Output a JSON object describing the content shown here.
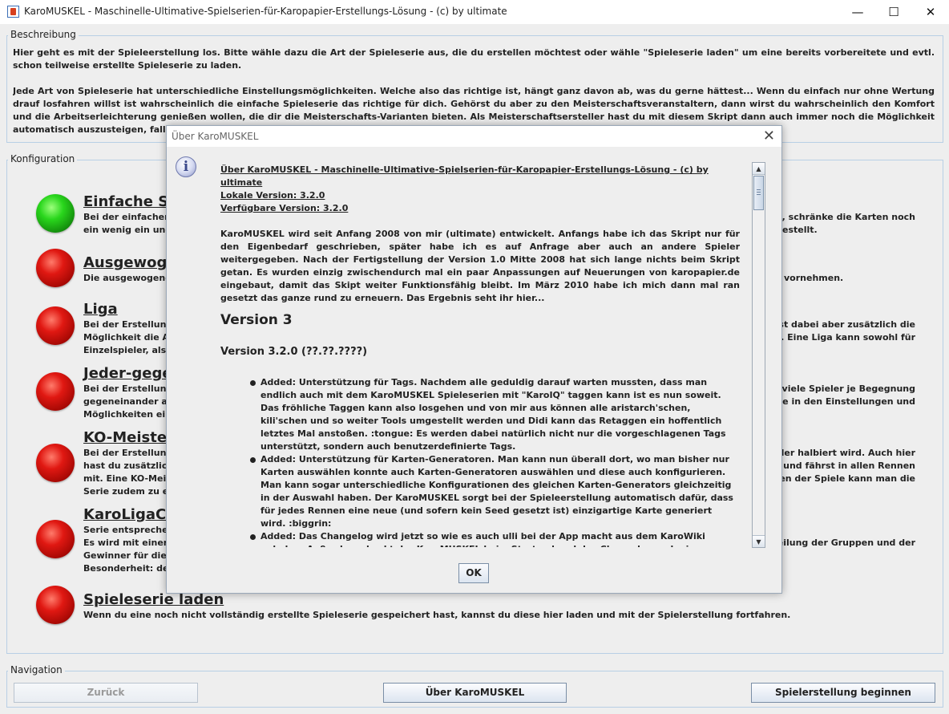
{
  "window": {
    "title": "KaroMUSKEL - Maschinelle-Ultimative-Spielserien-für-Karopapier-Erstellungs-Lösung - (c) by ultimate"
  },
  "beschreibung": {
    "title": "Beschreibung",
    "para1": "Hier geht es mit der Spieleerstellung los. Bitte wähle dazu die Art der Spieleserie aus, die du erstellen möchtest oder wähle \"Spieleserie laden\" um eine bereits vorbereitete und evtl. schon teilweise erstellte Spieleserie zu laden.",
    "para2": "Jede Art von Spieleserie hat unterschiedliche Einstellungsmöglichkeiten. Welche also das richtige ist, hängt ganz davon ab, was du gerne hättest... Wenn du einfach nur ohne Wertung drauf losfahren willst ist wahrscheinlich die einfache Spieleserie das richtige für dich. Gehörst du aber zu den Meisterschaftsveranstaltern, dann wirst du wahrscheinlich den Komfort und die Arbeitserleichterung genießen wollen, die dir die Meisterschafts-Varianten bieten. Als Meisterschaftsersteller hast du mit diesem Skript dann auch immer noch die Möglichkeit automatisch auszusteigen, falls es dir dann dochmal zu viele Spiele werden..."
  },
  "konfiguration": {
    "title": "Konfiguration",
    "items": [
      {
        "title": "Einfache Sp",
        "lines": [
          "Bei der einfachen",
          "ein wenig ein und s"
        ],
        "right": [
          "est, schränke die Karten noch",
          "estellt."
        ],
        "status": "green"
      },
      {
        "title": "Ausgewoge",
        "lines": [
          "Die ausgewogene"
        ],
        "right": [
          "vornehmen."
        ],
        "status": "red"
      },
      {
        "title": "Liga",
        "lines": [
          "Bei der Erstellung",
          "Möglichkeit die An",
          "Einzelspieler, als a"
        ],
        "right": [
          "ast dabei aber zusätzlich die",
          "mit. Eine Liga kann sowohl für"
        ],
        "status": "red"
      },
      {
        "title": "Jeder-gegen",
        "lines": [
          "Bei der Erstellung",
          "gegeneinander an",
          "Möglichkeiten eine"
        ],
        "right": [
          "vie viele Spieler je Begegnung",
          "erie in den Einstellungen und"
        ],
        "status": "red"
      },
      {
        "title": "KO-Meisters",
        "lines": [
          "Bei der Erstellung",
          "hast du zusätzlich",
          "mit. Eine KO-Meist",
          "Serie zudem zu ein"
        ],
        "right": [
          "pieler halbiert wird. Auch hier",
          "ein und fährst in allen Rennen",
          "ellen der Spiele kann man die"
        ],
        "status": "red"
      },
      {
        "title": "KaroLigaCu",
        "lines": [
          "Serie entsprechen",
          "Es wird mit einer",
          "Gewinner für die n",
          "Besonderheit: der"
        ],
        "right": [
          "uteilung der Gruppen und der"
        ],
        "status": "red"
      },
      {
        "title": "Spieleserie laden",
        "lines": [
          "Wenn du eine noch nicht vollständig erstellte Spieleserie gespeichert hast, kannst du diese hier laden und mit der Spielerstellung fortfahren."
        ],
        "right": [],
        "status": "red"
      }
    ]
  },
  "navigation": {
    "title": "Navigation",
    "back": "Zurück",
    "about": "Über KaroMUSKEL",
    "start": "Spielerstellung beginnen"
  },
  "dialog": {
    "title": "Über KaroMUSKEL",
    "heading": "Über KaroMUSKEL - Maschinelle-Ultimative-Spielserien-für-Karopapier-Erstellungs-Lösung - (c) by ultimate",
    "local_version": "Lokale Version: 3.2.0",
    "available_version": "Verfügbare Version: 3.2.0",
    "intro": "KaroMUSKEL wird seit Anfang 2008 von mir (ultimate) entwickelt. Anfangs habe ich das Skript nur für den Eigenbedarf geschrieben, später habe ich es auf Anfrage aber auch an andere Spieler weitergegeben. Nach der Fertigstellung der Version 1.0 Mitte 2008 hat sich lange nichts beim Skript getan. Es wurden einzig zwischendurch mal ein paar Anpassungen auf Neuerungen von karopapier.de eingebaut, damit das Skipt weiter Funktionsfähig bleibt. Im März 2010 habe ich mich dann mal ran gesetzt das ganze rund zu erneuern. Das Ergebnis seht ihr hier...",
    "version_major": "Version 3",
    "version_minor": "Version 3.2.0 (??.??.????)",
    "changes": [
      "Added: Unterstützung für Tags. Nachdem alle geduldig darauf warten mussten, dass man endlich auch mit dem KaroMUSKEL Spieleserien mit \"KaroIQ\" taggen kann ist es nun soweit. Das fröhliche Taggen kann also losgehen und von mir aus können alle aristarch'schen, kili'schen und so weiter Tools umgestellt werden und Didi kann das Retaggen ein hoffentlich letztes Mal anstoßen. :tongue: Es werden dabei natürlich nicht nur die vorgeschlagenen Tags unterstützt, sondern auch benutzerdefinierte Tags.",
      "Added: Unterstützung für Karten-Generatoren. Man kann nun überall dort, wo man bisher nur Karten auswählen konnte auch Karten-Generatoren auswählen und diese auch konfigurieren. Man kann sogar unterschiedliche Konfigurationen des gleichen Karten-Generators gleichzeitig in der Auswahl haben. Der KaroMUSKEL sorgt bei der Spieleerstellung automatisch dafür, dass für jedes Rennen eine neue (und sofern kein Seed gesetzt ist) einzigartige Karte generiert wird. :biggrin:",
      "Added: Das Changelog wird jetzt so wie es auch ulli bei der App macht aus dem KaroWiki geladen. Außerdem checkt der KaroMUSKEL beim Start anhand des Changelogs, ob eine neuere Version verfügbar ist und gibt dann eine Warnung aus. Das hilft zwar nichts beim Umstieg auf dieses Tag- &"
    ],
    "ok": "OK"
  }
}
